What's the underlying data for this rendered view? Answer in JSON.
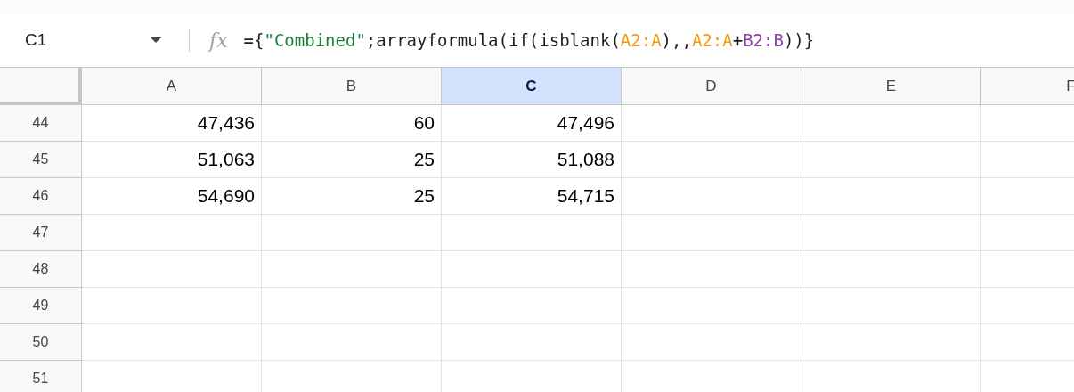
{
  "formula_bar": {
    "name_box": "C1",
    "fx_label": "fx",
    "formula": [
      {
        "text": "={",
        "color": "#1f1f1f"
      },
      {
        "text": "\"Combined\"",
        "color": "#188038"
      },
      {
        "text": ";arrayformula(if(isblank(",
        "color": "#1f1f1f"
      },
      {
        "text": "A2:A",
        "color": "#f29b0d"
      },
      {
        "text": "),,",
        "color": "#1f1f1f"
      },
      {
        "text": "A2:A",
        "color": "#f29b0d"
      },
      {
        "text": "+",
        "color": "#1f1f1f"
      },
      {
        "text": "B2:B",
        "color": "#8e3fa8"
      },
      {
        "text": "))}",
        "color": "#1f1f1f"
      }
    ]
  },
  "columns": [
    {
      "label": "A",
      "selected": false
    },
    {
      "label": "B",
      "selected": false
    },
    {
      "label": "C",
      "selected": true
    },
    {
      "label": "D",
      "selected": false
    },
    {
      "label": "E",
      "selected": false
    },
    {
      "label": "F",
      "selected": false
    }
  ],
  "rows": [
    {
      "number": "44",
      "cells": [
        "47,436",
        "60",
        "47,496"
      ]
    },
    {
      "number": "45",
      "cells": [
        "51,063",
        "25",
        "51,088"
      ]
    },
    {
      "number": "46",
      "cells": [
        "54,690",
        "25",
        "54,715"
      ]
    },
    {
      "number": "47"
    },
    {
      "number": "48"
    },
    {
      "number": "49"
    },
    {
      "number": "50"
    },
    {
      "number": "51"
    }
  ]
}
